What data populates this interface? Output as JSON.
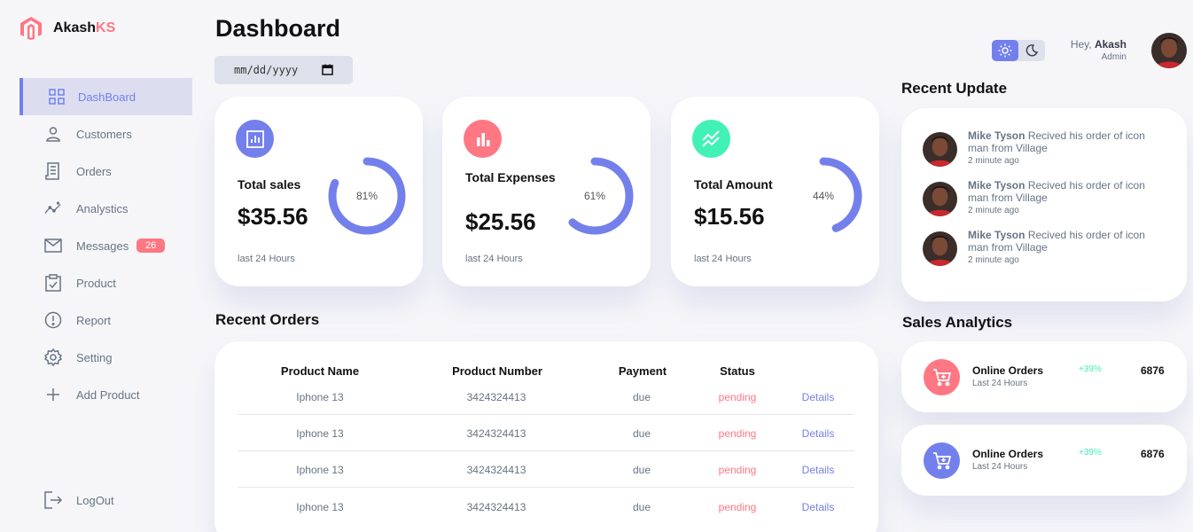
{
  "brand": {
    "name_main": "Akash",
    "name_accent": "KS"
  },
  "sidebar": {
    "items": [
      {
        "label": "DashBoard",
        "icon": "grid-icon"
      },
      {
        "label": "Customers",
        "icon": "person-icon"
      },
      {
        "label": "Orders",
        "icon": "receipt-icon"
      },
      {
        "label": "Analystics",
        "icon": "insights-icon"
      },
      {
        "label": "Messages",
        "icon": "mail-icon",
        "badge": "26"
      },
      {
        "label": "Product",
        "icon": "inventory-icon"
      },
      {
        "label": "Report",
        "icon": "report-icon"
      },
      {
        "label": "Setting",
        "icon": "settings-icon"
      },
      {
        "label": "Add Product",
        "icon": "add-icon"
      }
    ],
    "logout": "LogOut"
  },
  "main": {
    "title": "Dashboard",
    "date_placeholder": "mm/dd/yyyy",
    "cards": [
      {
        "label": "Total sales",
        "value": "$35.56",
        "percent": "81%",
        "fraction": 0.81,
        "note": "last 24 Hours",
        "color": "#7380ec",
        "icon": "analytics-icon"
      },
      {
        "label": "Total Expenses",
        "value": "$25.56",
        "percent": "61%",
        "fraction": 0.61,
        "note": "last 24 Hours",
        "color": "#ff7782",
        "icon": "bar-chart-icon"
      },
      {
        "label": "Total Amount",
        "value": "$15.56",
        "percent": "44%",
        "fraction": 0.44,
        "note": "last 24 Hours",
        "color": "#41f1b6",
        "icon": "stacked-line-chart-icon"
      }
    ],
    "recent_orders": {
      "title": "Recent Orders",
      "headers": [
        "Product Name",
        "Product Number",
        "Payment",
        "Status"
      ],
      "rows": [
        {
          "name": "Iphone 13",
          "number": "3424324413",
          "payment": "due",
          "status": "pending",
          "action": "Details"
        },
        {
          "name": "Iphone 13",
          "number": "3424324413",
          "payment": "due",
          "status": "pending",
          "action": "Details"
        },
        {
          "name": "Iphone 13",
          "number": "3424324413",
          "payment": "due",
          "status": "pending",
          "action": "Details"
        },
        {
          "name": "Iphone 13",
          "number": "3424324413",
          "payment": "due",
          "status": "pending",
          "action": "Details"
        }
      ]
    }
  },
  "right": {
    "greeting": "Hey,",
    "user_name": "Akash",
    "role": "Admin",
    "recent_update": {
      "title": "Recent Update",
      "items": [
        {
          "name": "Mike Tyson",
          "text": "Recived his order of icon man from Village",
          "time": "2 minute ago"
        },
        {
          "name": "Mike Tyson",
          "text": "Recived his order of icon man from Village",
          "time": "2 minute ago"
        },
        {
          "name": "Mike Tyson",
          "text": "Recived his order of icon man from Village",
          "time": "2 minute ago"
        }
      ]
    },
    "sales_analytics": {
      "title": "Sales Analytics",
      "items": [
        {
          "title": "Online Orders",
          "subtitle": "Last 24 Hours",
          "change": "+39%",
          "count": "6876",
          "color": "#ff7782"
        },
        {
          "title": "Online Orders",
          "subtitle": "Last 24 Hours",
          "change": "+39%",
          "count": "6876",
          "color": "#7380ec"
        }
      ]
    }
  },
  "colors": {
    "primary": "#7380ec",
    "danger": "#ff7782",
    "success": "#41f1b6"
  }
}
